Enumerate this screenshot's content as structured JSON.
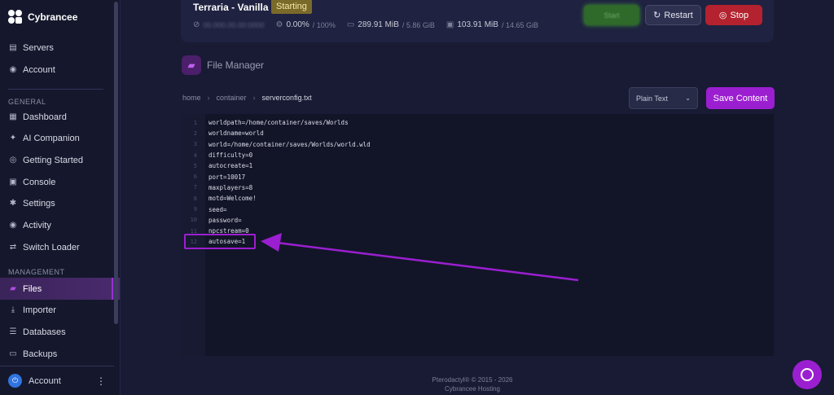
{
  "brand": {
    "name": "Cybrancee"
  },
  "sidebar": {
    "top_items": [
      {
        "label": "Servers",
        "icon": "server-icon"
      },
      {
        "label": "Account",
        "icon": "user-icon"
      }
    ],
    "general_heading": "GENERAL",
    "general_items": [
      {
        "label": "Dashboard",
        "icon": "grid-icon"
      },
      {
        "label": "AI Companion",
        "icon": "sparkle-icon"
      },
      {
        "label": "Getting Started",
        "icon": "compass-icon"
      },
      {
        "label": "Console",
        "icon": "terminal-icon"
      },
      {
        "label": "Settings",
        "icon": "gear-icon"
      },
      {
        "label": "Activity",
        "icon": "eye-icon"
      },
      {
        "label": "Switch Loader",
        "icon": "switch-icon"
      }
    ],
    "management_heading": "MANAGEMENT",
    "management_items": [
      {
        "label": "Files",
        "icon": "folder-icon",
        "active": true
      },
      {
        "label": "Importer",
        "icon": "download-icon"
      },
      {
        "label": "Databases",
        "icon": "database-icon"
      },
      {
        "label": "Backups",
        "icon": "archive-icon"
      }
    ],
    "account_label": "Account"
  },
  "server": {
    "name": "Terraria - Vanilla",
    "status": "Starting",
    "ip": "00.000.00.00:0000",
    "cpu": "0.00%",
    "cpu_limit": "/ 100%",
    "memory": "289.91 MiB",
    "memory_limit": "/ 5.86 GiB",
    "disk": "103.91 MiB",
    "disk_limit": "/ 14.65 GiB",
    "start_label": "Start",
    "restart_label": "Restart",
    "stop_label": "Stop"
  },
  "file_manager": {
    "title": "File Manager",
    "breadcrumb": [
      "home",
      "container",
      "serverconfig.txt"
    ],
    "mode_label": "Plain Text",
    "save_label": "Save Content"
  },
  "editor": {
    "lines": [
      "worldpath=/home/container/saves/Worlds",
      "worldname=world",
      "world=/home/container/saves/Worlds/world.wld",
      "difficulty=0",
      "autocreate=1",
      "port=10017",
      "maxplayers=8",
      "motd=Welcome!",
      "seed=",
      "password=",
      "npcstream=0",
      "autosave=1"
    ],
    "highlighted_line": 12
  },
  "footer": {
    "line1": "Pterodactyl® © 2015 - 2026",
    "line2": "Cybrancee Hosting"
  },
  "colors": {
    "accent": "#9b1fd0",
    "stop": "#b3222e",
    "status_badge": "#7a6a2a"
  }
}
